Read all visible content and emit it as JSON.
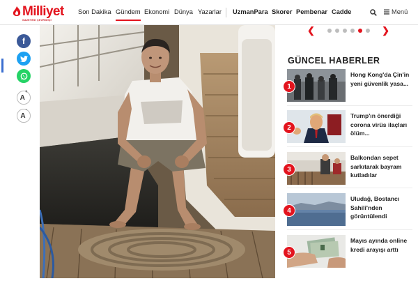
{
  "site": {
    "logo_text": "Milliyet",
    "logo_tagline": "GAZETESİ ÇEVRİMİÇİ"
  },
  "nav": {
    "items": [
      "Son Dakika",
      "Gündem",
      "Ekonomi",
      "Dünya",
      "Yazarlar",
      "UzmanPara",
      "Skorer",
      "Pembenar",
      "Cadde"
    ],
    "active": "Gündem",
    "menu_label": "Menü"
  },
  "share": {
    "facebook_glyph": "f",
    "twitter_glyph": "t",
    "whatsapp_glyph": "w",
    "font_increase": "A",
    "font_increase_sign": "+",
    "font_decrease": "A",
    "font_decrease_sign": "-"
  },
  "sidebar": {
    "pager_prev": "❮",
    "pager_next": "❯",
    "pager_active_index": 4,
    "section_title": "GÜNCEL HABERLER",
    "news": [
      {
        "num": "1",
        "title": "Hong Kong'da Çin'in yeni güvenlik yasa..."
      },
      {
        "num": "2",
        "title": "Trump'ın önerdiği corona virüs ilaçları ölüm..."
      },
      {
        "num": "3",
        "title": "Balkondan sepet sarkıtarak bayram kutladılar"
      },
      {
        "num": "4",
        "title": "Uludağ, Bostancı Sahili'nden görüntülendi"
      },
      {
        "num": "5",
        "title": "Mayıs ayında online kredi arayışı arttı"
      }
    ]
  },
  "colors": {
    "brand_red": "#e3141e",
    "facebook": "#3b5998",
    "twitter": "#1da1f2",
    "whatsapp": "#25d366"
  },
  "icons": [
    "search-icon",
    "hamburger-menu-icon",
    "facebook-icon",
    "twitter-icon",
    "whatsapp-icon",
    "font-increase-icon",
    "font-decrease-icon",
    "chevron-left-icon",
    "chevron-right-icon"
  ]
}
